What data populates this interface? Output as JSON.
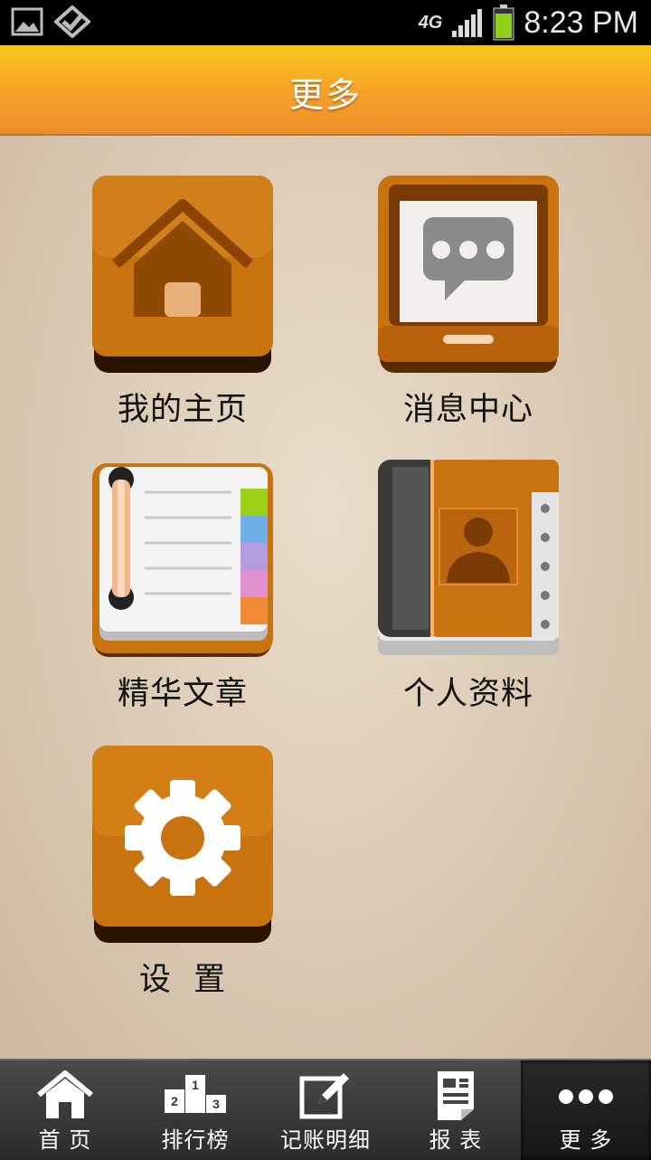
{
  "status_bar": {
    "network": "4G",
    "time": "8:23 PM"
  },
  "header": {
    "title": "更多"
  },
  "tiles": [
    {
      "label": "我的主页",
      "icon": "home-icon"
    },
    {
      "label": "消息中心",
      "icon": "message-center-icon"
    },
    {
      "label": "精华文章",
      "icon": "notebook-icon"
    },
    {
      "label": "个人资料",
      "icon": "contacts-book-icon"
    },
    {
      "label": "设  置",
      "icon": "gear-icon"
    }
  ],
  "bottom_nav": {
    "items": [
      {
        "label": "首 页",
        "icon": "home-icon"
      },
      {
        "label": "排行榜",
        "icon": "podium-icon",
        "podium": [
          "2",
          "1",
          "3"
        ]
      },
      {
        "label": "记账明细",
        "icon": "edit-icon"
      },
      {
        "label": "报 表",
        "icon": "report-icon"
      },
      {
        "label": "更 多",
        "icon": "more-icon"
      }
    ],
    "active_index": 4
  },
  "colors": {
    "header_gradient": [
      "#f7c51b",
      "#ef8d2a"
    ],
    "tile_orange": "#c96a0c",
    "background": "#d9c9b4",
    "nav_bg": "#333333"
  }
}
